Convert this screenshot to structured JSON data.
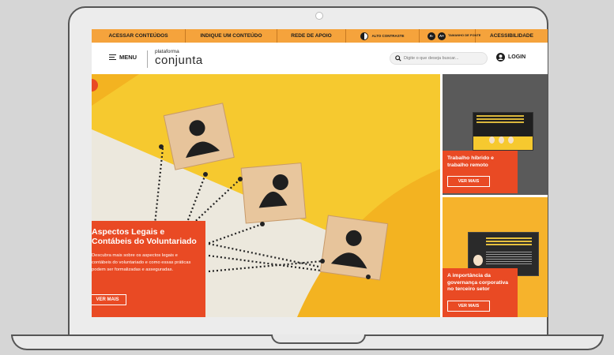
{
  "topbar": {
    "access_content": "ACESSAR CONTEÚDOS",
    "indicate_content": "INDIQUE UM CONTEÚDO",
    "support_network": "REDE DE APOIO",
    "high_contrast": "ALTO CONTRASTE",
    "font_decrease": "A-",
    "font_increase": "A+",
    "font_size_label": "TAMANHO DE FONTE",
    "accessibility": "ACESSIBILIDADE"
  },
  "header": {
    "menu_label": "MENU",
    "logo_top": "plataforma",
    "logo_main": "conjunta",
    "search_placeholder": "Digite o que deseja buscar...",
    "login_label": "LOGIN"
  },
  "hero": {
    "title": "Aspectos Legais e Contábeis do Voluntariado",
    "description": "Descubra mais sobre os aspectos legais e contábeis do voluntariado e como essas práticas podem ser formalizadas e asseguradas.",
    "button_label": "VER MAIS"
  },
  "side_cards": [
    {
      "title": "Trabalho híbrido e trabalho remoto",
      "button_label": "VER MAIS"
    },
    {
      "title": "A importância da governança corporativa no terceiro setor",
      "button_label": "VER MAIS"
    }
  ],
  "colors": {
    "accent_orange": "#f5a33c",
    "card_red": "#e94a24",
    "hero_yellow": "#f6c92f"
  }
}
